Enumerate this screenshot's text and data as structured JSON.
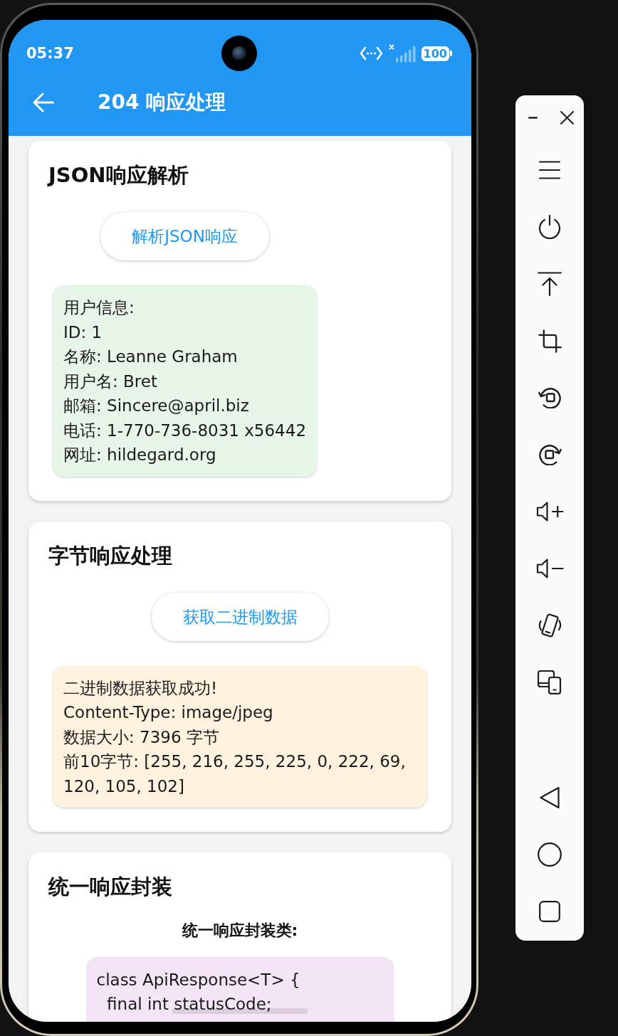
{
  "status_bar": {
    "time": "05:37",
    "battery": "100"
  },
  "app_bar": {
    "title": "204 响应处理"
  },
  "cards": [
    {
      "kind": "result",
      "title": "JSON响应解析",
      "button": "解析JSON响应",
      "panel": {
        "color": "#e8f5e9",
        "lines": [
          "用户信息:",
          "ID: 1",
          "名称: Leanne Graham",
          "用户名: Bret",
          "邮箱: Sincere@april.biz",
          "电话: 1-770-736-8031 x56442",
          "网址: hildegard.org"
        ]
      }
    },
    {
      "kind": "result",
      "title": "字节响应处理",
      "button": "获取二进制数据",
      "panel": {
        "color": "#fff3e0",
        "lines": [
          "二进制数据获取成功!",
          "Content-Type: image/jpeg",
          "数据大小: 7396 字节",
          "前10字节: [255, 216, 255, 225, 0, 222, 69, 120, 105, 102]"
        ]
      }
    },
    {
      "kind": "code",
      "title": "统一响应封装",
      "subtitle": "统一响应封装类:",
      "panel": {
        "color": "#f3e5f5",
        "lines": [
          "class ApiResponse<T> {",
          "  final int statusCode;"
        ]
      }
    }
  ]
}
